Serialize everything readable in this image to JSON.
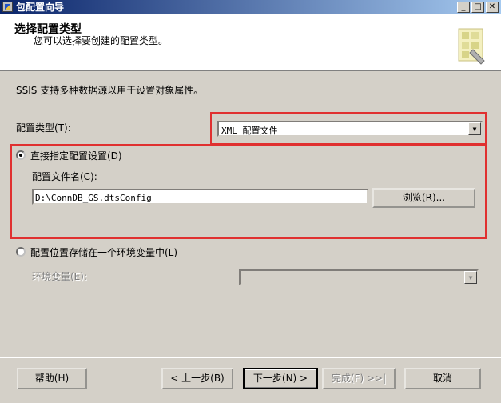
{
  "window": {
    "title": "包配置向导",
    "icon": "package-wizard-icon"
  },
  "header": {
    "title": "选择配置类型",
    "subtitle": "您可以选择要创建的配置类型。"
  },
  "body": {
    "intro": "SSIS 支持多种数据源以用于设置对象属性。",
    "config_type_label": "配置类型(T):",
    "config_type_value": "XML 配置文件",
    "option_direct": {
      "label": "直接指定配置设置(D)",
      "selected": true
    },
    "config_file_label": "配置文件名(C):",
    "config_file_value": "D:\\ConnDB_GS.dtsConfig",
    "browse_label": "浏览(R)...",
    "option_env": {
      "label": "配置位置存储在一个环境变量中(L)",
      "selected": false
    },
    "env_var_label": "环境变量(E):",
    "env_var_value": ""
  },
  "footer": {
    "help": "帮助(H)",
    "back": "< 上一步(B)",
    "next": "下一步(N) >",
    "finish": "完成(F) >>|",
    "cancel": "取消"
  },
  "colors": {
    "highlight": "#e03030",
    "titlebar_start": "#0a246a",
    "titlebar_end": "#a6caf0"
  }
}
